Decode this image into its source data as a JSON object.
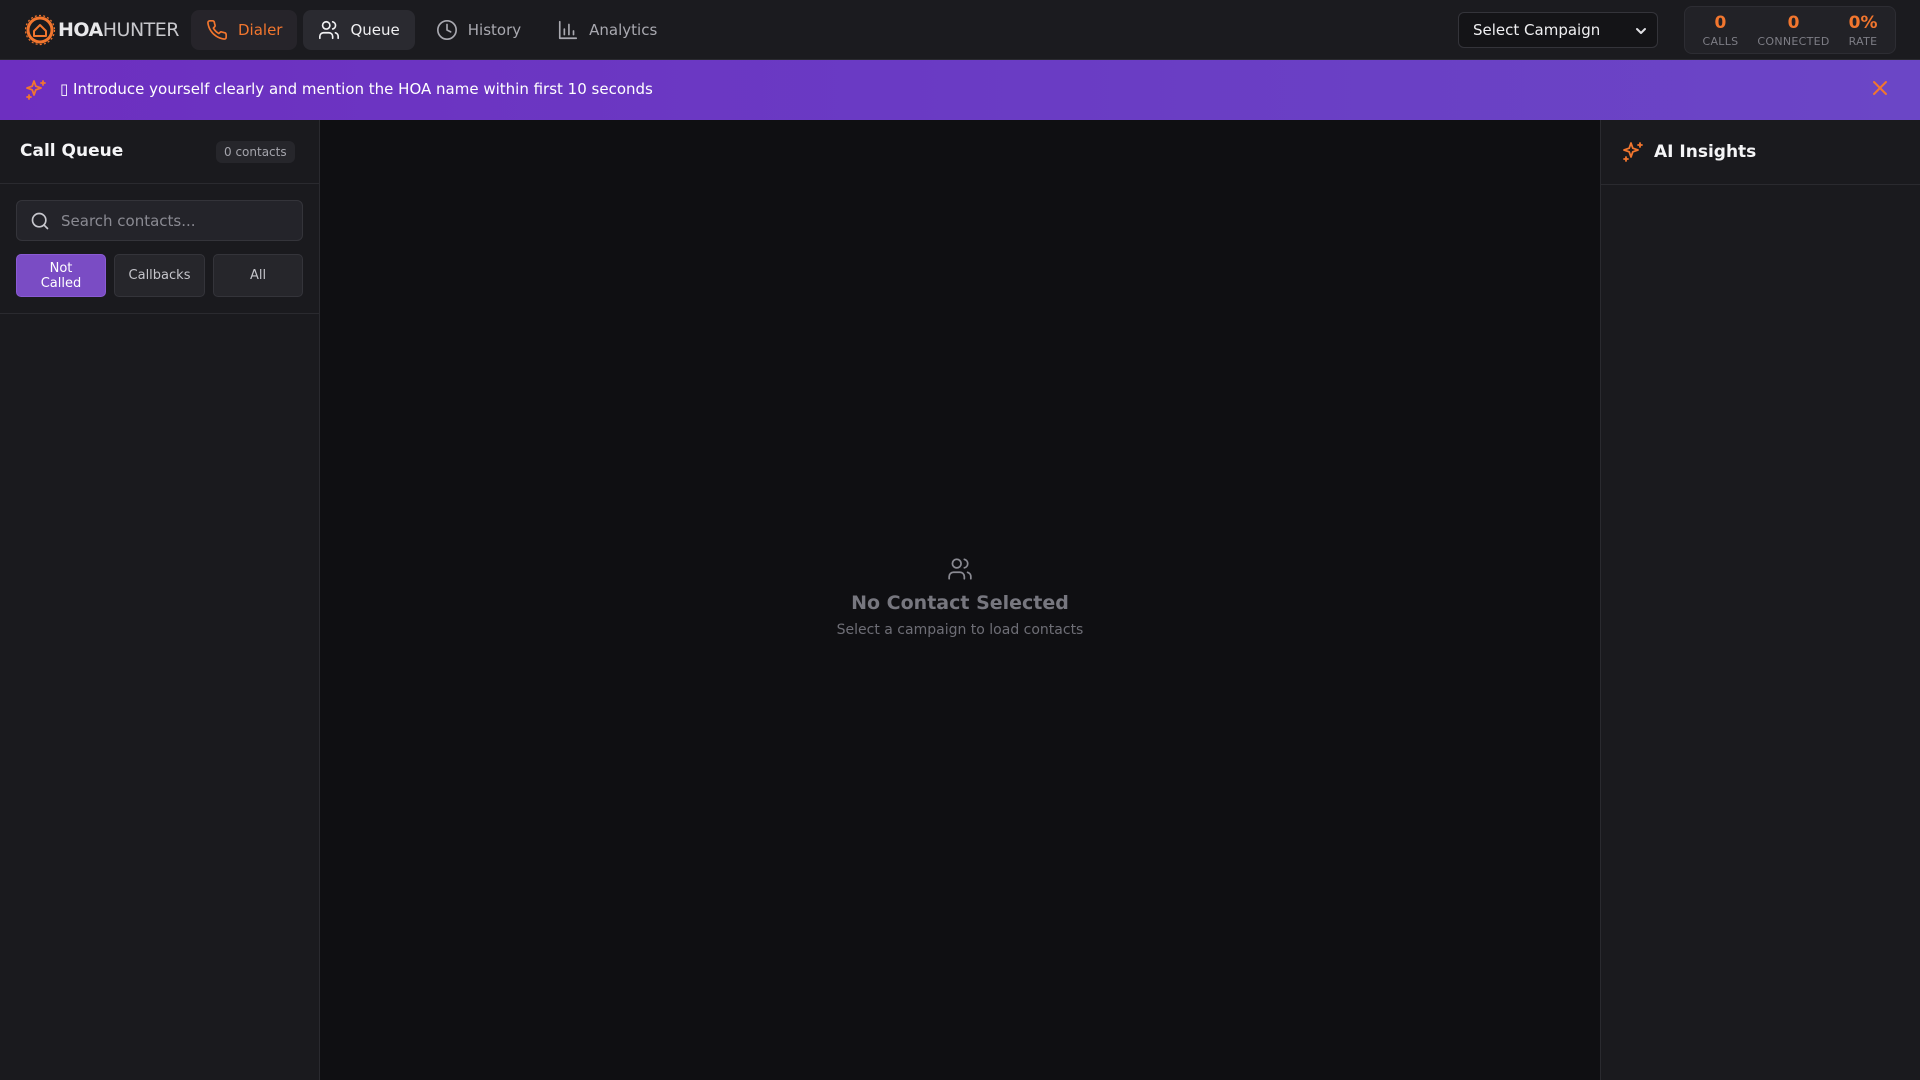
{
  "app": {
    "logo_text_bold": "HOA",
    "logo_text_light": "HUNTER",
    "accent_color": "#f2762e",
    "banner_color": "#6d2fc0"
  },
  "nav": {
    "items": [
      {
        "label": "Dialer",
        "icon": "phone-icon"
      },
      {
        "label": "Queue",
        "icon": "users-icon"
      },
      {
        "label": "History",
        "icon": "clock-icon"
      },
      {
        "label": "Analytics",
        "icon": "bar-chart-icon"
      }
    ]
  },
  "campaign": {
    "selected": "Select Campaign"
  },
  "stats": {
    "calls_value": "0",
    "calls_label": "CALLS",
    "connected_value": "0",
    "connected_label": "CONNECTED",
    "rate_value": "0%",
    "rate_label": "RATE"
  },
  "banner": {
    "text": "Introduce yourself clearly and mention the HOA name within first 10 seconds",
    "leading_glyph": "▯"
  },
  "sidebar": {
    "title": "Call Queue",
    "contacts_count": "0 contacts",
    "search_placeholder": "Search contacts...",
    "filters": [
      {
        "label": "Not Called",
        "active": true
      },
      {
        "label": "Callbacks",
        "active": false
      },
      {
        "label": "All",
        "active": false
      }
    ]
  },
  "main": {
    "empty_title": "No Contact Selected",
    "empty_subtitle": "Select a campaign to load contacts"
  },
  "insights": {
    "title": "AI Insights"
  }
}
